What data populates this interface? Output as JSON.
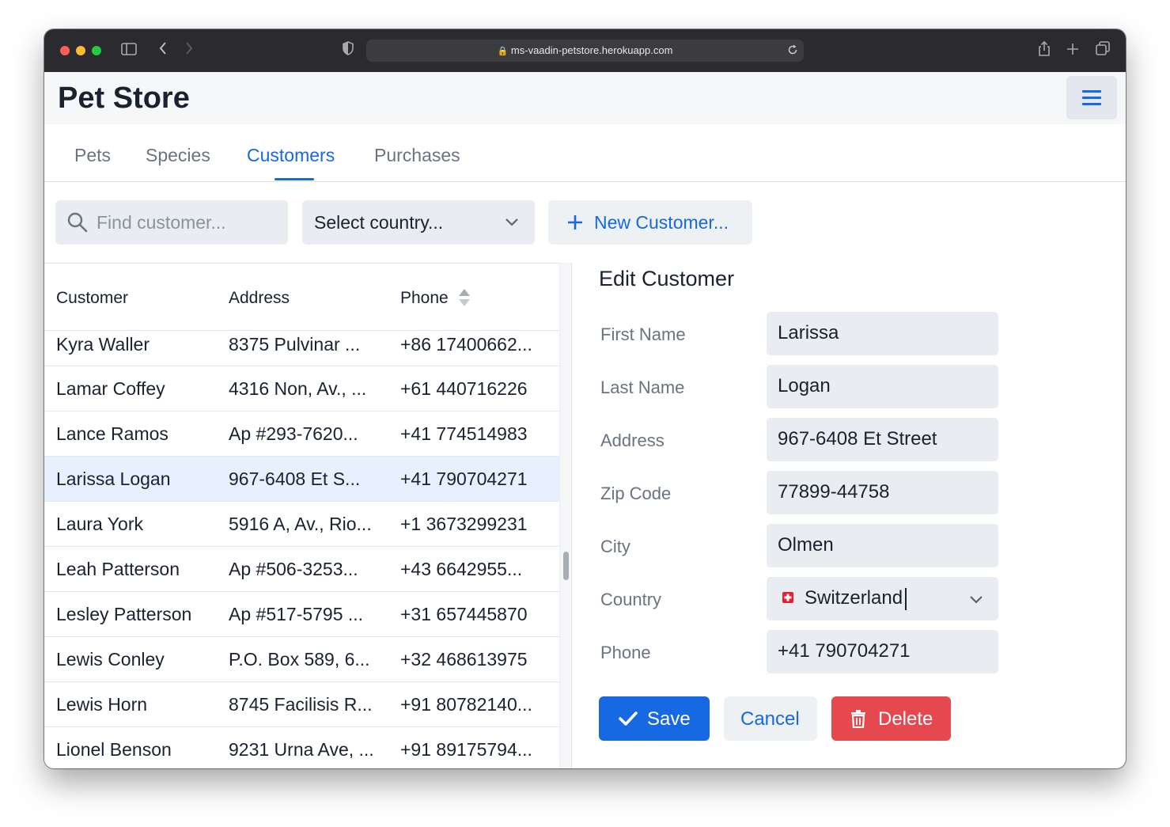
{
  "browser": {
    "url": "ms-vaadin-petstore.herokuapp.com"
  },
  "app": {
    "title": "Pet Store"
  },
  "tabs": [
    {
      "label": "Pets",
      "active": false
    },
    {
      "label": "Species",
      "active": false
    },
    {
      "label": "Customers",
      "active": true
    },
    {
      "label": "Purchases",
      "active": false
    }
  ],
  "toolbar": {
    "search_placeholder": "Find customer...",
    "country_select": "Select country...",
    "new_customer_label": "New Customer..."
  },
  "grid": {
    "columns": [
      "Customer",
      "Address",
      "Phone"
    ],
    "rows": [
      {
        "customer": "Kyra Waller",
        "address": "8375 Pulvinar ...",
        "phone": "+86 17400662...",
        "selected": false
      },
      {
        "customer": "Lamar Coffey",
        "address": "4316 Non, Av., ...",
        "phone": "+61 440716226",
        "selected": false
      },
      {
        "customer": "Lance Ramos",
        "address": "Ap #293-7620...",
        "phone": "+41 774514983",
        "selected": false
      },
      {
        "customer": "Larissa Logan",
        "address": "967-6408 Et S...",
        "phone": "+41 790704271",
        "selected": true
      },
      {
        "customer": "Laura York",
        "address": "5916 A, Av., Rio...",
        "phone": "+1 3673299231",
        "selected": false
      },
      {
        "customer": "Leah Patterson",
        "address": "Ap #506-3253...",
        "phone": "+43 6642955...",
        "selected": false
      },
      {
        "customer": "Lesley Patterson",
        "address": "Ap #517-5795 ...",
        "phone": "+31 657445870",
        "selected": false
      },
      {
        "customer": "Lewis Conley",
        "address": "P.O. Box 589, 6...",
        "phone": "+32 468613975",
        "selected": false
      },
      {
        "customer": "Lewis Horn",
        "address": "8745 Facilisis R...",
        "phone": "+91 80782140...",
        "selected": false
      },
      {
        "customer": "Lionel Benson",
        "address": "9231 Urna Ave, ...",
        "phone": "+91 89175794...",
        "selected": false
      }
    ]
  },
  "form": {
    "title": "Edit Customer",
    "fields": [
      {
        "label": "First Name",
        "value": "Larissa"
      },
      {
        "label": "Last Name",
        "value": "Logan"
      },
      {
        "label": "Address",
        "value": "967-6408 Et Street"
      },
      {
        "label": "Zip Code",
        "value": "77899-44758"
      },
      {
        "label": "City",
        "value": "Olmen"
      },
      {
        "label": "Country",
        "value": "Switzerland"
      },
      {
        "label": "Phone",
        "value": "+41 790704271"
      }
    ],
    "save_label": "Save",
    "cancel_label": "Cancel",
    "delete_label": "Delete"
  },
  "colors": {
    "accent": "#1668e3",
    "danger": "#e5484f",
    "selected_row": "#e7f0fc"
  }
}
